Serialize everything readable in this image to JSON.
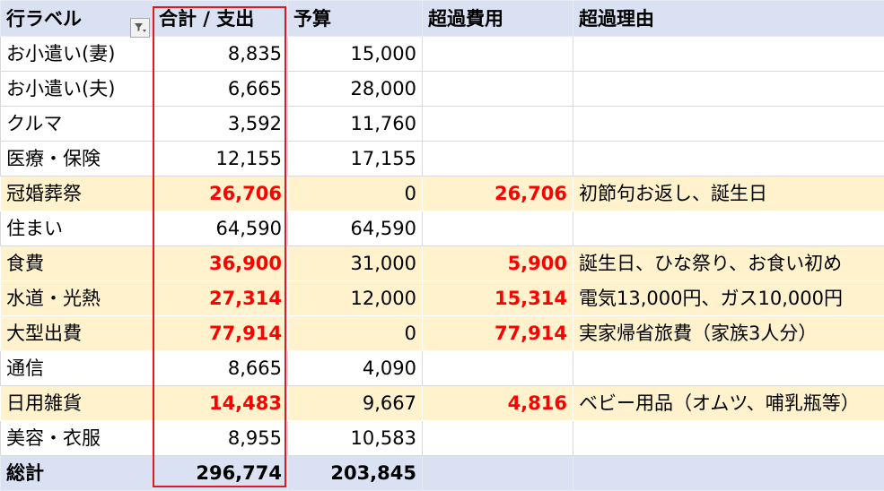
{
  "headers": [
    "行ラベル",
    "合計 / 支出",
    "予算",
    "超過費用",
    "超過理由"
  ],
  "rows": [
    {
      "label": "お小遣い(妻)",
      "spend": "8,835",
      "budget": "15,000",
      "over": "",
      "reason": "",
      "highlight": false
    },
    {
      "label": "お小遣い(夫)",
      "spend": "6,665",
      "budget": "28,000",
      "over": "",
      "reason": "",
      "highlight": false
    },
    {
      "label": "クルマ",
      "spend": "3,592",
      "budget": "11,760",
      "over": "",
      "reason": "",
      "highlight": false
    },
    {
      "label": "医療・保険",
      "spend": "12,155",
      "budget": "17,155",
      "over": "",
      "reason": "",
      "highlight": false
    },
    {
      "label": "冠婚葬祭",
      "spend": "26,706",
      "budget": "0",
      "over": "26,706",
      "reason": "初節句お返し、誕生日",
      "highlight": true
    },
    {
      "label": "住まい",
      "spend": "64,590",
      "budget": "64,590",
      "over": "",
      "reason": "",
      "highlight": false
    },
    {
      "label": "食費",
      "spend": "36,900",
      "budget": "31,000",
      "over": "5,900",
      "reason": "誕生日、ひな祭り、お食い初め",
      "highlight": true
    },
    {
      "label": "水道・光熱",
      "spend": "27,314",
      "budget": "12,000",
      "over": "15,314",
      "reason": "電気13,000円、ガス10,000円",
      "highlight": true
    },
    {
      "label": "大型出費",
      "spend": "77,914",
      "budget": "0",
      "over": "77,914",
      "reason": "実家帰省旅費（家族3人分）",
      "highlight": true
    },
    {
      "label": "通信",
      "spend": "8,665",
      "budget": "4,090",
      "over": "",
      "reason": "",
      "highlight": false
    },
    {
      "label": "日用雑貨",
      "spend": "14,483",
      "budget": "9,667",
      "over": "4,816",
      "reason": "ベビー用品（オムツ、哺乳瓶等）",
      "highlight": true
    },
    {
      "label": "美容・衣服",
      "spend": "8,955",
      "budget": "10,583",
      "over": "",
      "reason": "",
      "highlight": false
    }
  ],
  "total": {
    "label": "総計",
    "spend": "296,774",
    "budget": "203,845"
  },
  "colors": {
    "header_bg": "#d9e1f2",
    "highlight_bg": "#fff2cc",
    "over_text": "#ff0000",
    "selection_border": "#e0191f"
  },
  "icons": {
    "filter": "filter-dropdown-icon"
  }
}
